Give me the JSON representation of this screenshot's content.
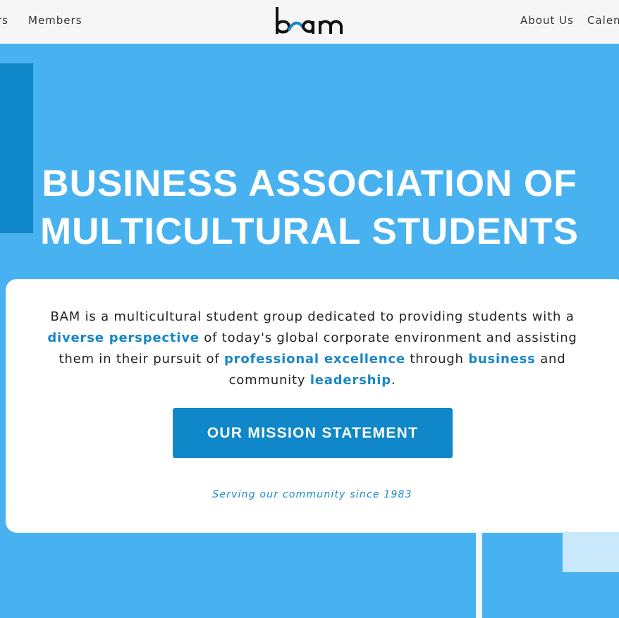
{
  "nav": {
    "left_items": [
      "rs",
      "Members"
    ],
    "right_items": [
      "About Us",
      "Calen"
    ]
  },
  "logo": {
    "text": "bam",
    "accent_color": "#1787c9"
  },
  "hero": {
    "title_line1": "BUSINESS ASSOCIATION OF",
    "title_line2": "MULTICULTURAL STUDENTS"
  },
  "card": {
    "description": {
      "p1": "BAM is a multicultural student group dedicated to providing students with a ",
      "h1": "diverse perspective",
      "p2": " of today's global corporate environment and assisting them in their pursuit of ",
      "h2": "professional excellence",
      "p3": " through ",
      "h3": "business",
      "p4": " and community ",
      "h4": "leadership",
      "p5": "."
    },
    "mission_button": "OUR MISSION STATEMENT",
    "tagline": "Serving our community since 1983"
  },
  "colors": {
    "hero_background": "#48b2f0",
    "accent_dark": "#0f87c9",
    "highlight_text": "#1787c9",
    "topbar_background": "#f6f6f6"
  }
}
